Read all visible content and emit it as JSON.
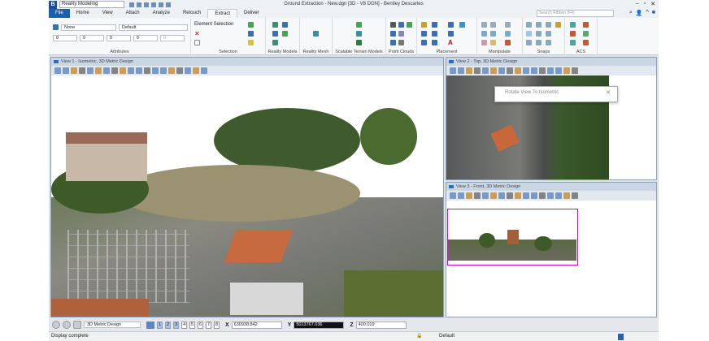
{
  "app": {
    "logo": "B",
    "workspace": "Reality Modeling",
    "title": "Ground Extraction - New.dgn [3D - V8 DGN] - Bentley Descartes",
    "window_controls": [
      "–",
      "▫",
      "✕"
    ]
  },
  "ribbon": {
    "tabs": [
      "File",
      "Home",
      "View",
      "Attach",
      "Analyze",
      "Retouch",
      "Extract",
      "Deliver"
    ],
    "active_tab": "Extract",
    "search_placeholder": "Search Ribbon (F4)",
    "attributes": {
      "level": "None",
      "style": "Default",
      "fields": [
        "0",
        "0",
        "0",
        "0",
        "0"
      ]
    },
    "selection": {
      "element_selection": "Element Selection"
    },
    "groups": [
      "Attributes",
      "Selection",
      "Reality Models",
      "Reality Mesh",
      "Scalable Terrain Models",
      "Point Clouds",
      "Placement",
      "Manipulate",
      "Snaps",
      "ACS"
    ]
  },
  "views": [
    {
      "title": "View 1 - Isometric, 3D Metric Design"
    },
    {
      "title": "View 2 - Top, 3D Metric Design"
    },
    {
      "title": "View 3 - Front, 3D Metric Design"
    }
  ],
  "dialog": {
    "title": "Rotate View To Isometric"
  },
  "bottom": {
    "model": "3D Metric Design",
    "view_numbers": [
      "1",
      "2",
      "3",
      "4",
      "5",
      "6",
      "7",
      "8"
    ],
    "active_views": [
      "1",
      "2",
      "3"
    ],
    "x_label": "X",
    "x": "630938.842",
    "y_label": "Y",
    "y": "5013767.036",
    "z_label": "Z",
    "z": "400.019"
  },
  "status": {
    "message": "Display complete",
    "level": "Default"
  },
  "colors": {
    "accent": "#1b5fb3",
    "view_title": "#cbd6e4",
    "fence": "#d000d0"
  }
}
